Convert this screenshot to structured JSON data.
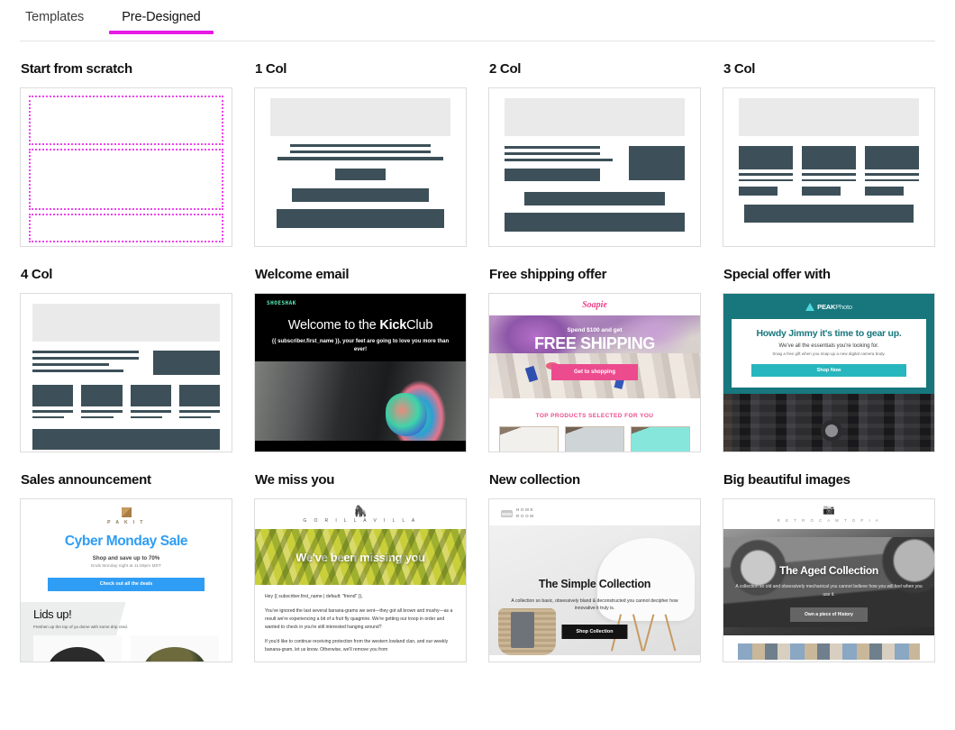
{
  "theme": {
    "accent": "#e619e6",
    "wireframe_bar": "#3d5059",
    "wireframe_head": "#eaeaea",
    "card_border": "#dcdcdc",
    "scratch_dotted": "#ee44ee"
  },
  "tabs": [
    {
      "label": "Templates",
      "active": false
    },
    {
      "label": "Pre-Designed",
      "active": true
    }
  ],
  "cards": [
    {
      "title": "Start from scratch",
      "kind": "scratch"
    },
    {
      "title": "1 Col",
      "kind": "wireframe-1col"
    },
    {
      "title": "2 Col",
      "kind": "wireframe-2col"
    },
    {
      "title": "3 Col",
      "kind": "wireframe-3col"
    },
    {
      "title": "4 Col",
      "kind": "wireframe-4col"
    },
    {
      "title": "Welcome email",
      "kind": "email-shoeshak",
      "logo": "SHOESHAK",
      "headline_plain": "Welcome to the ",
      "headline_bold": "Kick",
      "headline_tail": "Club",
      "subtext": "{{ subscriber.first_name }}, your feet are going to love you more than ever!"
    },
    {
      "title": "Free shipping offer",
      "kind": "email-soapie",
      "logo": "Soapie",
      "pretitle": "Spend $100 and get",
      "headline": "FREE SHIPPING",
      "cta": "Get to shopping",
      "section_label": "TOP PRODUCTS SELECTED FOR YOU"
    },
    {
      "title": "Special offer with",
      "kind": "email-peakphoto",
      "logo_bold": "PEAK",
      "logo_light": "Photo",
      "headline": "Howdy Jimmy it's time to gear up.",
      "sub1": "We've all the essentials you're looking for.",
      "sub2": "Snag a free gift when you snap up a new digital camera body.",
      "cta": "Shop Now"
    },
    {
      "title": "Sales announcement",
      "kind": "email-pakit",
      "logo": "P A K I T",
      "headline": "Cyber Monday Sale",
      "sub1": "Shop and save up to 70%",
      "sub2": "Ends Monday night at 11:59pm MDT",
      "cta": "Check out all the deals",
      "section_heading": "Lids up!",
      "section_sub": "Freshen up the top of ya dome with some drip cred."
    },
    {
      "title": "We miss you",
      "kind": "email-gorillavilla",
      "logo": "G O R I L L A V I L L A",
      "hero_text": "We've been missing you",
      "body": [
        "Hey {{ subscriber.first_name | default: \"friend\" }},",
        "You've ignored the last several banana-grams we sent—they got all brown and mushy—as a result we're experiencing a bit of a fruit fly quagmire. We're getting our troop in order and wanted to check in you're still interested hanging around?",
        "If you'd like to continue receiving protection from the western lowland clan, and our weekly banana-gram, let us know. Otherwise, we'll remove you from"
      ]
    },
    {
      "title": "New collection",
      "kind": "email-homeroom",
      "logo_line1": "HOME",
      "logo_line2": "ROOM",
      "headline": "The Simple Collection",
      "sub": "A collection so basic, obsessively bland & deconstructed you cannot decipher how innovative it truly is.",
      "cta": "Shop Collection"
    },
    {
      "title": "Big beautiful images",
      "kind": "email-retrocamtopia",
      "logo": "R E T R O C A M T O P I A",
      "headline": "The Aged Collection",
      "sub": "A collection so old and obsessively mechanical you cannot believe how you will feel when you use it.",
      "cta": "Own a piece of History"
    }
  ]
}
